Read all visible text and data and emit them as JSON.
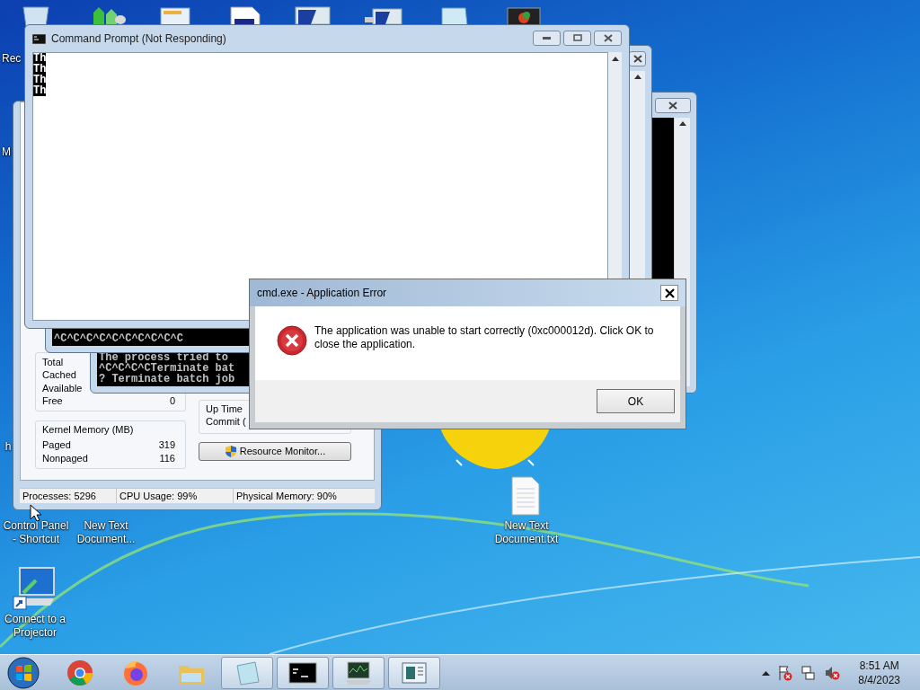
{
  "desktop_icons": [
    {
      "label": [
        "Rec"
      ]
    },
    {
      "label": [
        "M"
      ]
    },
    {
      "label": [
        "h"
      ]
    },
    {
      "label": [
        "Control Panel",
        "- Shortcut"
      ]
    },
    {
      "label": [
        "New Text",
        "Document..."
      ]
    },
    {
      "label": [
        "New Text",
        "Document.txt"
      ]
    },
    {
      "label": [
        "Connect to a",
        "Projector"
      ]
    }
  ],
  "task_manager": {
    "memory_rows": [
      {
        "label": "Total"
      },
      {
        "label": "Cached"
      },
      {
        "label": "Available"
      },
      {
        "label": "Free",
        "value": "0"
      }
    ],
    "kernel_memory": {
      "title": "Kernel Memory (MB)",
      "rows": [
        {
          "label": "Paged",
          "value": "319"
        },
        {
          "label": "Nonpaged",
          "value": "116"
        }
      ]
    },
    "system_rows": [
      "Up Time",
      "Commit ("
    ],
    "resource_monitor_button": "Resource Monitor...",
    "status_bar": [
      "Processes: 5296",
      "CPU Usage: 99%",
      "Physical Memory: 90%"
    ]
  },
  "console_back": {
    "lines": [
      "^C^C^C^C^C^C^C^C^C^C"
    ]
  },
  "console_middle": {
    "lines": [
      "The process tried to",
      "^C^C^C^CTerminate bat",
      "? Terminate batch job"
    ]
  },
  "command_prompt": {
    "title": "Command Prompt (Not Responding)",
    "lines": [
      "Th",
      "Th",
      "Th",
      "Th"
    ]
  },
  "error_dialog": {
    "title": "cmd.exe - Application Error",
    "message": "The application was unable to start correctly (0xc000012d). Click OK to close the application.",
    "button": "OK"
  },
  "taskbar": {
    "items": [
      {
        "running": false
      },
      {
        "running": false
      },
      {
        "running": false
      },
      {
        "running": true
      },
      {
        "running": true
      },
      {
        "running": true
      },
      {
        "running": true
      }
    ],
    "clock": {
      "time": "8:51 AM",
      "date": "8/4/2023"
    }
  }
}
